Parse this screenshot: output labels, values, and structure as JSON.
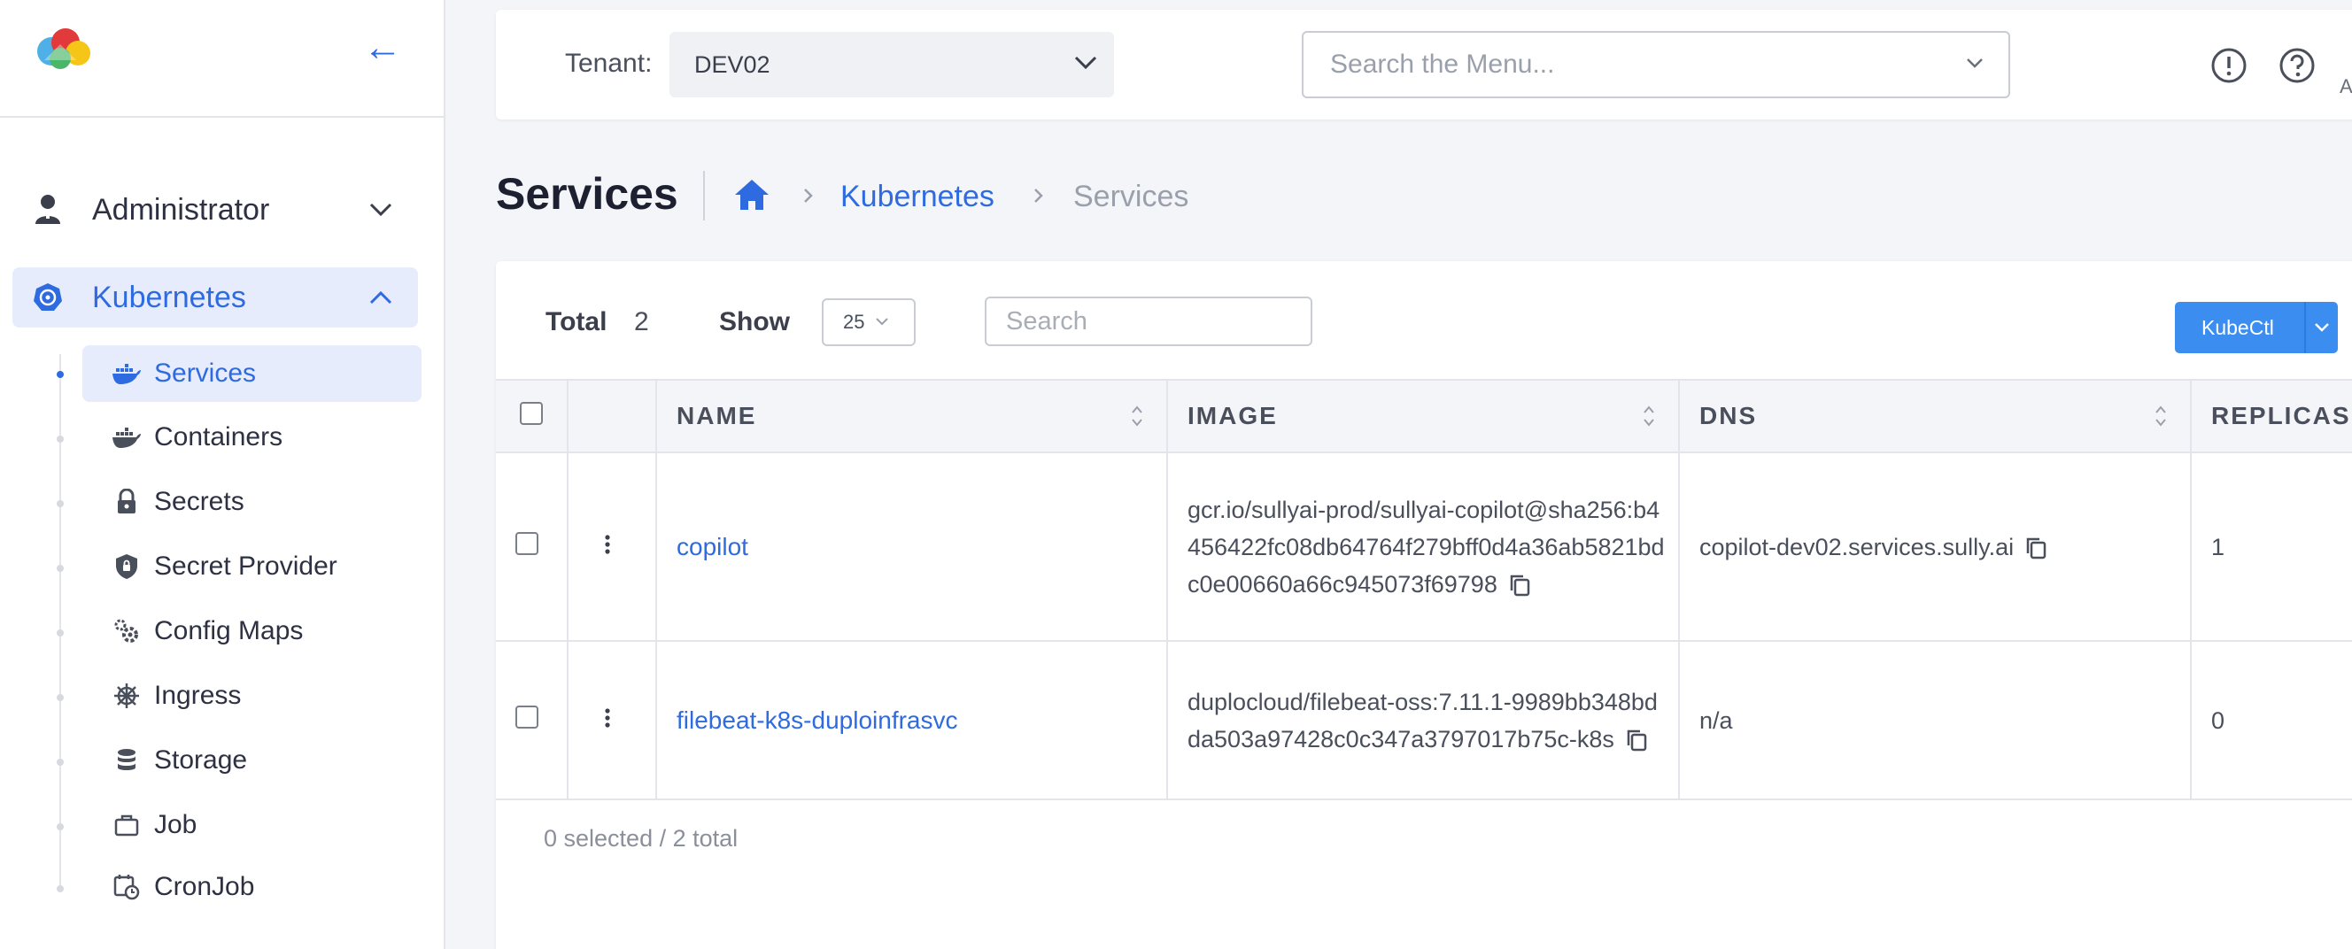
{
  "sidebar": {
    "groups": [
      {
        "label": "Administrator",
        "icon": "user-icon"
      },
      {
        "label": "Kubernetes",
        "icon": "kubernetes-icon"
      }
    ],
    "items": [
      {
        "label": "Services",
        "icon": "docker-icon"
      },
      {
        "label": "Containers",
        "icon": "docker-icon"
      },
      {
        "label": "Secrets",
        "icon": "lock-icon"
      },
      {
        "label": "Secret Provider",
        "icon": "shield-icon"
      },
      {
        "label": "Config Maps",
        "icon": "gears-icon"
      },
      {
        "label": "Ingress",
        "icon": "helm-icon"
      },
      {
        "label": "Storage",
        "icon": "database-icon"
      },
      {
        "label": "Job",
        "icon": "briefcase-icon"
      },
      {
        "label": "CronJob",
        "icon": "calendar-clock-icon"
      }
    ],
    "active_item": "Services"
  },
  "header": {
    "tenant_label": "Tenant:",
    "tenant_value": "DEV02",
    "menu_search_placeholder": "Search the Menu...",
    "user_initial": "A"
  },
  "page": {
    "title": "Services",
    "breadcrumb": [
      "Kubernetes",
      "Services"
    ]
  },
  "toolbar": {
    "total_label": "Total",
    "total_value": "2",
    "show_label": "Show",
    "show_value": "25",
    "search_placeholder": "Search",
    "kubectl_label": "KubeCtl"
  },
  "table": {
    "columns": [
      "NAME",
      "IMAGE",
      "DNS",
      "REPLICAS"
    ],
    "rows": [
      {
        "name": "copilot",
        "image": "gcr.io/sullyai-prod/sullyai-copilot@sha256:b4456422fc08db64764f279bff0d4a36ab5821bdc0e00660a66c945073f69798",
        "dns": "copilot-dev02.services.sully.ai",
        "replicas": "1"
      },
      {
        "name": "filebeat-k8s-duploinfrasvc",
        "image": "duplocloud/filebeat-oss:7.11.1-9989bb348bdda503a97428c0c347a3797017b75c-k8s",
        "dns": "n/a",
        "replicas": "0"
      }
    ],
    "footer": "0 selected / 2 total"
  },
  "colors": {
    "accent": "#2f6be0",
    "active_bg": "#e6ecfb",
    "button": "#3b8ef0"
  }
}
